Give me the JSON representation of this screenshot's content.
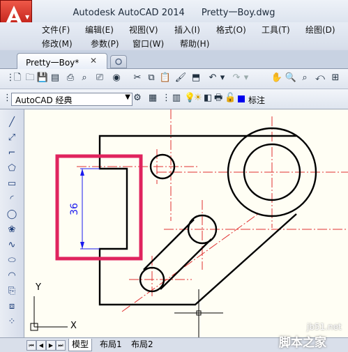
{
  "window": {
    "app_title": "Autodesk AutoCAD 2014",
    "file_name": "Pretty一Boy.dwg"
  },
  "menu": {
    "row1": [
      "文件(F)",
      "编辑(E)",
      "视图(V)",
      "插入(I)",
      "格式(O)",
      "工具(T)",
      "绘图(D)"
    ],
    "row2": [
      "修改(M)",
      "参数(P)",
      "窗口(W)",
      "帮助(H)"
    ]
  },
  "tabs": {
    "document_tab": "Pretty一Boy*",
    "close_glyph": "✕"
  },
  "toolbar": {
    "workspace": "AutoCAD 经典",
    "layer": "标注",
    "layer_color": "#0000ee"
  },
  "drawing": {
    "dimension_text": "36",
    "ucs_y_label": "Y",
    "ucs_x_label": "X",
    "highlight_color": "#e0245e",
    "dimension_color": "#1a1aee",
    "centerline_color": "#e03030"
  },
  "layout_tabs": [
    "模型",
    "布局1",
    "布局2"
  ],
  "watermark": {
    "site": "jb51.net",
    "brand": "脚本之家"
  }
}
